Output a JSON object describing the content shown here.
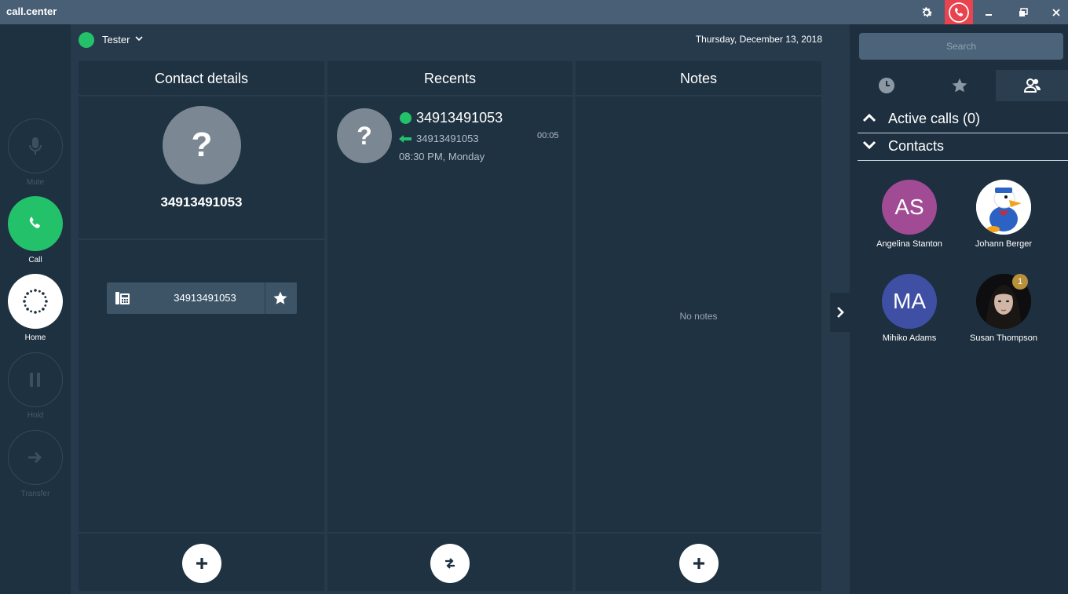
{
  "app": {
    "title": "call.center"
  },
  "user": {
    "name": "Tester",
    "status_color": "#24c16b"
  },
  "date": "Thursday, December 13, 2018",
  "rail": {
    "mute": "Mute",
    "call": "Call",
    "home": "Home",
    "hold": "Hold",
    "transfer": "Transfer"
  },
  "panels": {
    "contact_details": {
      "title": "Contact details",
      "number": "34913491053",
      "phone_number": "34913491053",
      "avatar_glyph": "?"
    },
    "recents": {
      "title": "Recents",
      "item": {
        "number": "34913491053",
        "sub_number": "34913491053",
        "duration": "00:05",
        "time": "08:30 PM, Monday",
        "avatar_glyph": "?"
      }
    },
    "notes": {
      "title": "Notes",
      "empty": "No notes"
    }
  },
  "right": {
    "search_placeholder": "Search",
    "tabs": [
      "clock-icon",
      "star-icon",
      "people-icon"
    ],
    "active_tab": 2,
    "active_calls": "Active calls (0)",
    "contacts_label": "Contacts",
    "contacts": [
      {
        "initials": "AS",
        "name": "Angelina Stanton",
        "color": "#a24b95"
      },
      {
        "initials": "",
        "name": "Johann Berger",
        "color": "#ffffff"
      },
      {
        "initials": "MA",
        "name": "Mihiko Adams",
        "color": "#3f4fa3"
      },
      {
        "initials": "",
        "name": "Susan Thompson",
        "color": "#111111",
        "badge": "1"
      }
    ]
  },
  "colors": {
    "accent_green": "#24c16b",
    "hangup_red": "#e8434f",
    "titlebar": "#485f75"
  }
}
